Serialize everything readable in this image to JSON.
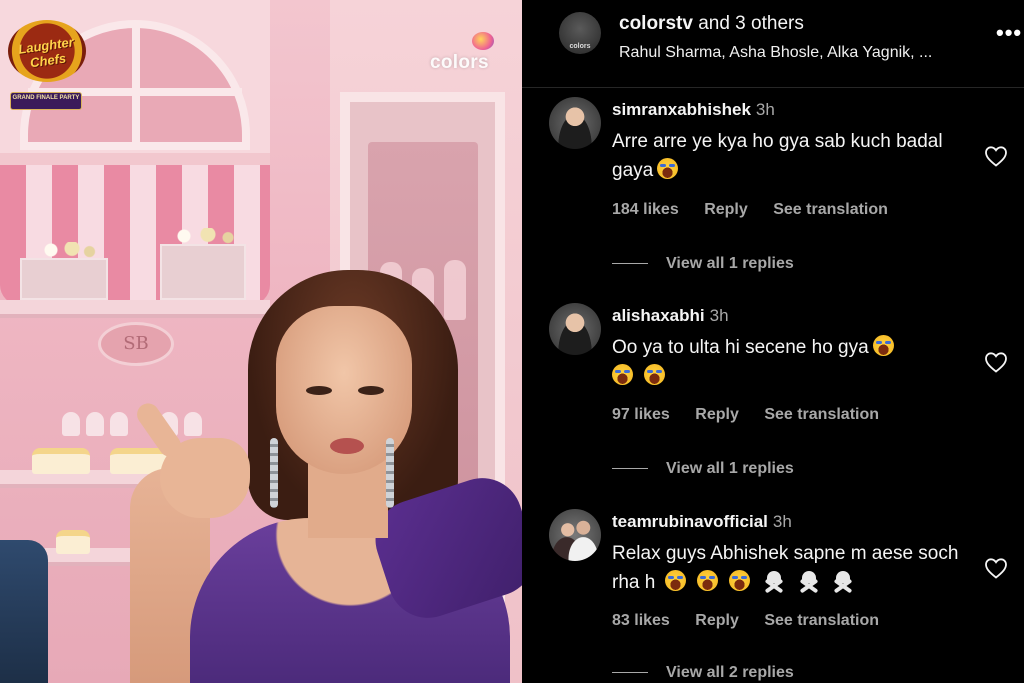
{
  "video": {
    "show_logo": {
      "title": "Laughter Chefs",
      "badge": "GRAND FINALE PARTY"
    },
    "channel_watermark": "colors",
    "plaque": "SB"
  },
  "header": {
    "account": "colorstv",
    "title_suffix": "and 3 others",
    "collaborators": "Rahul Sharma, Asha Bhosle, Alka Yagnik, ...",
    "avatar_text": "colors",
    "more_label": "•••"
  },
  "comments": [
    {
      "username": "simranxabhishek",
      "time": "3h",
      "text": "Arre arre ye kya ho gya sab kuch badal gaya",
      "emoji_count": 1,
      "likes": "184 likes",
      "reply": "Reply",
      "translate": "See translation",
      "view_replies": "View all 1 replies"
    },
    {
      "username": "alishaxabhi",
      "time": "3h",
      "text": "Oo ya to ulta hi secene ho gya",
      "emoji_count": 3,
      "likes": "97 likes",
      "reply": "Reply",
      "translate": "See translation",
      "view_replies": "View all 1 replies"
    },
    {
      "username": "teamrubinavofficial",
      "time": "3h",
      "text": "Relax guys Abhishek sapne m aese soch rha h",
      "emoji_count": 3,
      "skull_count": 3,
      "likes": "83 likes",
      "reply": "Reply",
      "translate": "See translation",
      "view_replies": "View all 2 replies"
    }
  ],
  "colors": {
    "background": "#000000",
    "primary_text": "#f5f5f5",
    "secondary_text": "#a8a8a8"
  }
}
